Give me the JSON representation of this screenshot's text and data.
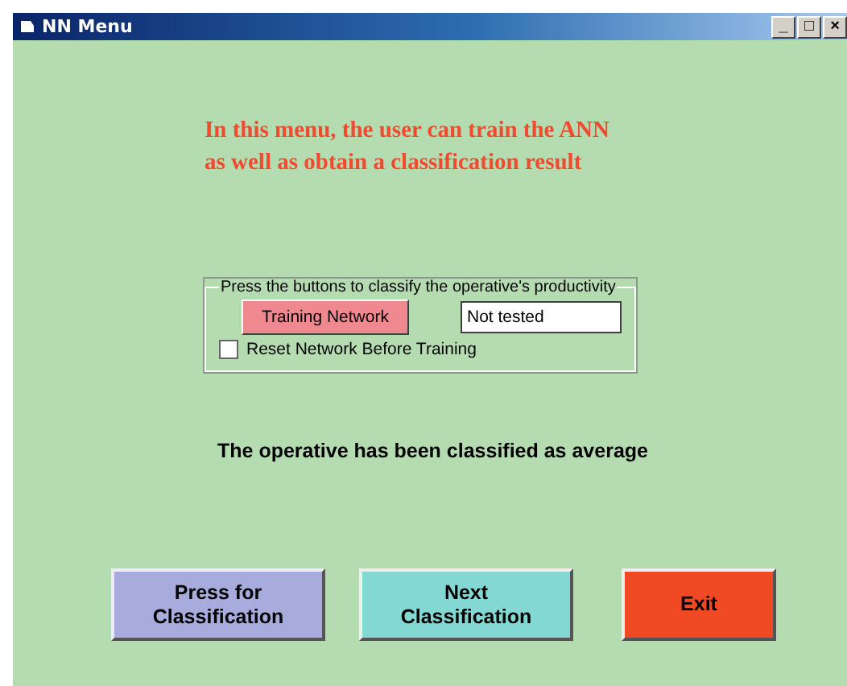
{
  "window": {
    "title": "NN Menu",
    "controls": [
      "_",
      "□",
      "×"
    ]
  },
  "intro": [
    "In this menu, the user can train the ANN",
    "as well as obtain a classification result"
  ],
  "group": {
    "title": "Press the buttons to classify the operative's productivity",
    "train_button": "Training Network",
    "result_field": {
      "value": "Not tested"
    },
    "reset_checkbox": {
      "label": "Reset Network Before Training",
      "checked": false
    }
  },
  "message": "The operative has been classified as average",
  "buttons": [
    {
      "label": "Press for Classification",
      "color": "#a8acdc"
    },
    {
      "label": "Next Classification",
      "color": "#84d8d4"
    },
    {
      "label": "Exit",
      "color": "#f04a24"
    }
  ]
}
